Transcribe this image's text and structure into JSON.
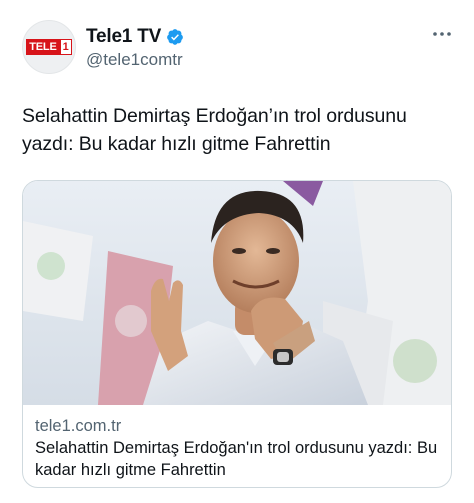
{
  "account": {
    "avatar_logo_text": "TELE",
    "avatar_logo_number": "1",
    "display_name": "Tele1 TV",
    "handle": "@tele1comtr",
    "verified": true,
    "verified_color": "#1d9bf0"
  },
  "tweet": {
    "text": "Selahattin Demirtaş Erdoğan’ın trol ordusunu yazdı: Bu kadar hızlı gitme Fahrettin"
  },
  "link_card": {
    "domain": "tele1.com.tr",
    "title": "Selahattin Demirtaş Erdoğan'ın trol ordusunu yazdı: Bu kadar hızlı gitme Fahrettin"
  },
  "icons": {
    "more": "more-options-icon",
    "verified": "verified-badge-icon"
  }
}
